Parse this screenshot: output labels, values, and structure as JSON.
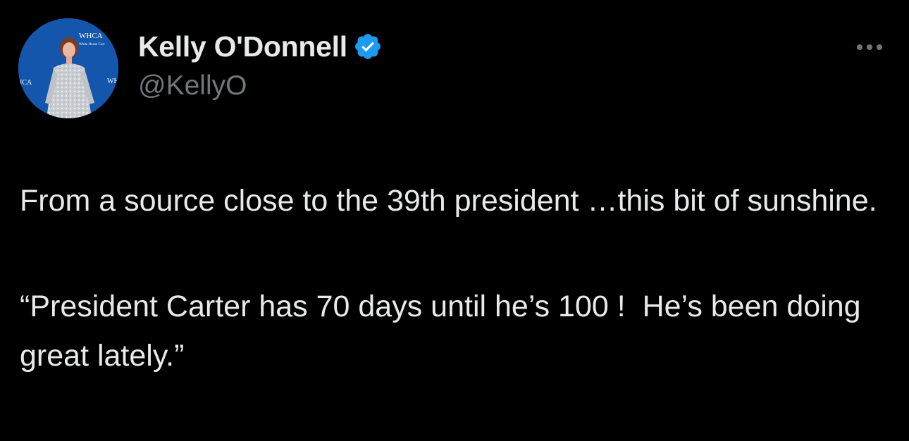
{
  "author": {
    "display_name": "Kelly O'Donnell",
    "handle": "@KellyO",
    "verified": true,
    "verified_icon": "verified-badge-icon",
    "avatar_backdrop_text": [
      "WHCA",
      "White House Corr",
      "ICA",
      "WH"
    ]
  },
  "menu": {
    "icon": "more-horizontal-icon"
  },
  "tweet": {
    "paragraphs": [
      "From a source close to the 39th president …this bit of sunshine.",
      "“President Carter has 70 days until he’s 100 !  He’s been doing great lately.”"
    ]
  },
  "colors": {
    "background": "#000000",
    "text_primary": "#e7e9ea",
    "text_secondary": "#71767b",
    "verified_blue": "#1d9bf0"
  }
}
